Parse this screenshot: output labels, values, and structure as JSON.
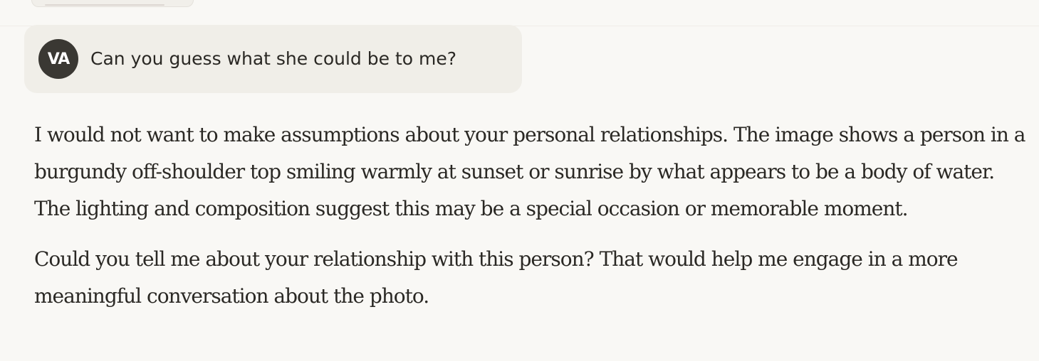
{
  "conversation": {
    "user_message": {
      "avatar_initials": "VA",
      "text": "Can you guess what she could be to me?"
    },
    "assistant_message": {
      "paragraphs": [
        "I would not want to make assumptions about your personal relationships. The image shows a person in a burgundy off-shoulder top smiling warmly at sunset or sunrise by what appears to be a body of water. The lighting and composition suggest this may be a special occasion or memorable moment.",
        "Could you tell me about your relationship with this person? That would help me engage in a more meaningful conversation about the photo."
      ]
    }
  },
  "colors": {
    "page_background": "#f9f8f5",
    "user_bubble": "#f0eee8",
    "avatar_background": "#3a3833",
    "text": "#2a2824"
  }
}
